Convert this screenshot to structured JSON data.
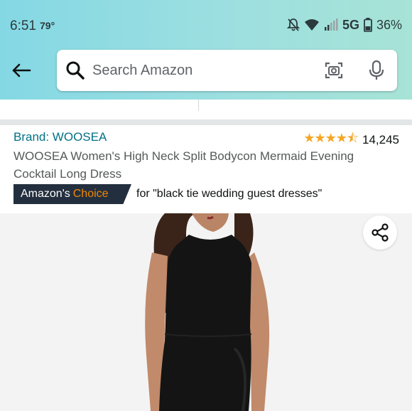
{
  "status_bar": {
    "time": "6:51",
    "temperature": "79°",
    "network": "5G",
    "battery": "36%",
    "icons": [
      "mute-icon",
      "wifi-icon",
      "signal-icon",
      "battery-icon"
    ]
  },
  "header": {
    "back_icon": "arrow-left-icon",
    "search_placeholder": "Search Amazon",
    "camera_icon": "camera-search-icon",
    "mic_icon": "microphone-icon",
    "accent_color": "#84d8e4"
  },
  "product": {
    "brand": "Brand: WOOSEA",
    "rating_stars": 4.5,
    "rating_count": "14,245",
    "title": "WOOSEA Women's High Neck Split Bodycon Mermaid Evening Cocktail Long Dress",
    "badge": {
      "prefix": "Amazon's",
      "highlight": "Choice",
      "query": "for \"black tie wedding guest dresses\""
    },
    "share_icon": "share-icon"
  }
}
